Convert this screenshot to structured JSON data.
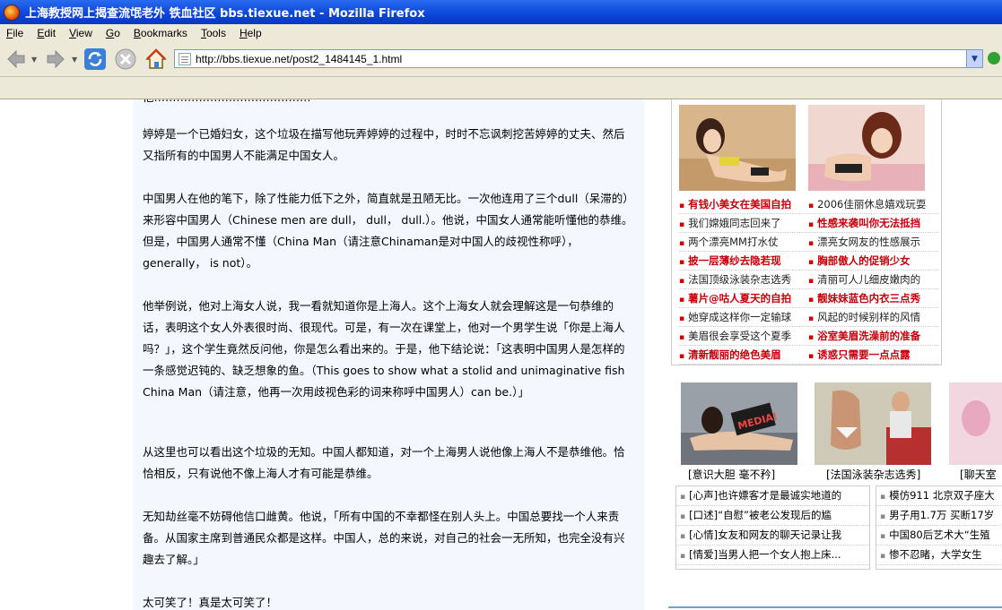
{
  "window": {
    "title": "上海教授网上揭查流氓老外 铁血社区 bbs.tiexue.net - Mozilla Firefox"
  },
  "menu": [
    "File",
    "Edit",
    "View",
    "Go",
    "Bookmarks",
    "Tools",
    "Help"
  ],
  "menu_accel": [
    "F",
    "E",
    "V",
    "G",
    "B",
    "T",
    "H"
  ],
  "menu_rest": [
    "ile",
    "dit",
    "iew",
    "o",
    "ookmarks",
    "ools",
    "elp"
  ],
  "address": {
    "url": "http://bbs.tiexue.net/post2_1484145_1.html"
  },
  "article": {
    "partial_top": "他……………………………………",
    "paragraphs": [
      "婷婷是一个已婚妇女，这个垃圾在描写他玩弄婷婷的过程中，时时不忘讽刺挖苦婷婷的丈夫、然后又指所有的中国男人不能满足中国女人。",
      "中国男人在他的笔下，除了性能力低下之外，简直就是丑陋无比。一次他连用了三个dull（呆滞的）来形容中国男人（Chinese men are dull， dull， dull.）。他说，中国女人通常能听懂他的恭维。但是，中国男人通常不懂（China Man（请注意Chinaman是对中国人的歧视性称呼）， generally， is not）。",
      "他举例说，他对上海女人说，我一看就知道你是上海人。这个上海女人就会理解这是一句恭维的话，表明这个女人外表很时尚、很现代。可是，有一次在课堂上，他对一个男学生说「你是上海人吗？」，这个学生竟然反问他，你是怎么看出来的。于是，他下结论说：「这表明中国男人是怎样的一条感觉迟钝的、缺乏想象的鱼。（This goes to show what a stolid and unimaginative fish China Man（请注意，他再一次用歧视色彩的词来称呼中国男人）can be.）」",
      "从这里也可以看出这个垃圾的无知。中国人都知道，对一个上海男人说他像上海人不是恭维他。恰恰相反，只有说他不像上海人才有可能是恭维。",
      "无知劫丝毫不妨碍他信口雌黄。他说，「所有中国的不幸都怪在别人头上。中国总要找一个人来责备。从国家主席到普通民众都是这样。中国人，总的来说，对自己的社会一无所知，也完全没有兴趣去了解。」",
      "太可笑了！真是太可笑了！"
    ]
  },
  "sidebar": {
    "links_left": [
      {
        "text": "有钱小美女在美国自拍",
        "style": "red"
      },
      {
        "text": "我们嫦娥同志回来了",
        "style": "blk"
      },
      {
        "text": "两个漂亮MM打水仗",
        "style": "blk"
      },
      {
        "text": "披一层薄纱去隐若现",
        "style": "red"
      },
      {
        "text": "法国顶级泳装杂志选秀",
        "style": "blk"
      },
      {
        "text": "薯片@咕人夏天的自拍",
        "style": "red"
      },
      {
        "text": "她穿成这样你一定输球",
        "style": "blk"
      },
      {
        "text": "美眉很会享受这个夏季",
        "style": "blk"
      },
      {
        "text": "清新靓丽的绝色美眉",
        "style": "red"
      }
    ],
    "links_right": [
      {
        "text": "2006佳丽休息嬉戏玩耍",
        "style": "blk"
      },
      {
        "text": "性感来袭叫你无法抵挡",
        "style": "red"
      },
      {
        "text": "漂亮女网友的性感展示",
        "style": "blk"
      },
      {
        "text": "胸部傲人的促销少女",
        "style": "red"
      },
      {
        "text": "清丽可人儿细皮嫩肉的",
        "style": "blk"
      },
      {
        "text": "靓妹妹蓝色内衣三点秀",
        "style": "red"
      },
      {
        "text": "风起的时候别样的风情",
        "style": "blk"
      },
      {
        "text": "浴室美眉洗澡前的准备",
        "style": "red"
      },
      {
        "text": "诱惑只需要一点点露",
        "style": "red"
      }
    ],
    "captions": [
      "[意识大胆 毫不矜]",
      "[法国泳装杂志选秀]",
      "[聊天室"
    ],
    "news_left": [
      "[心声]也许嫖客才是最诚实地道的",
      "[口述]“自慰”被老公发现后的尴",
      "[心情]女友和网友的聊天记录让我",
      "[情爱]当男人把一个女人抱上床..."
    ],
    "news_right": [
      "模仿911 北京双子座大",
      "男子用1.7万 买断17岁",
      "中国80后艺术大“生殖",
      "惨不忍睹，大学女生"
    ],
    "photo_text": "MEDIA!"
  },
  "colors": {
    "titlebar": "#0a45d8",
    "chrome": "#ece9d8",
    "article_bg": "#f4f8fe",
    "link_red": "#c8000a"
  }
}
